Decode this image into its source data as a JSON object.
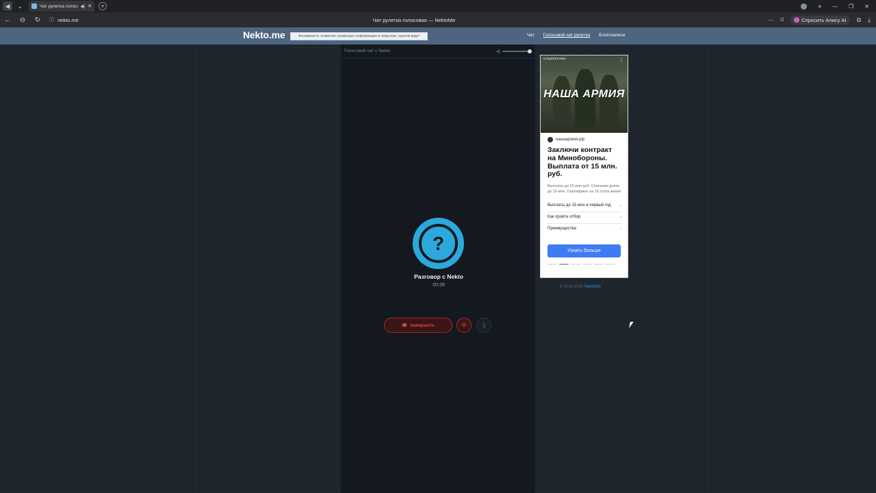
{
  "browser": {
    "tab_title": "Чат рулетка голосо",
    "url": "nekto.me",
    "window_title": "Чат рулетка голосовая — NektoMe",
    "alice_label": "Спросить Алису AI"
  },
  "site": {
    "logo": "Nekto.me",
    "notice": "Анонимность позволяет размещать информацию в открытом, сырном виде!",
    "nav": {
      "chat": "Чат",
      "voice": "Голосовой чат рулетка",
      "blog": "Блогозаписи"
    }
  },
  "chat": {
    "header": "Голосовой чат с Nekto",
    "avatar_symbol": "?",
    "title": "Разговор с Nekto",
    "timer": "00:28",
    "end_label": "Завершить",
    "volume_level": 1.0
  },
  "ad": {
    "label": "СОЦРЕКЛАМА",
    "brand": "НАША АРМИЯ",
    "domain": "нашаармия.рф",
    "headline": "Заключи контракт на Минобороны. Выплата от 15 млн. руб.",
    "description": "Выплаты до 15 млн руб. Списание долга до 10 млн. Сертификат на 10 соток земли",
    "links": [
      "Выплаты до 15 млн в первый год",
      "Как пройти отбор",
      "Преимущества"
    ],
    "cta": "Узнать больше"
  },
  "footer": {
    "copyright": "© 2011-2025",
    "link": "NektoMe"
  }
}
